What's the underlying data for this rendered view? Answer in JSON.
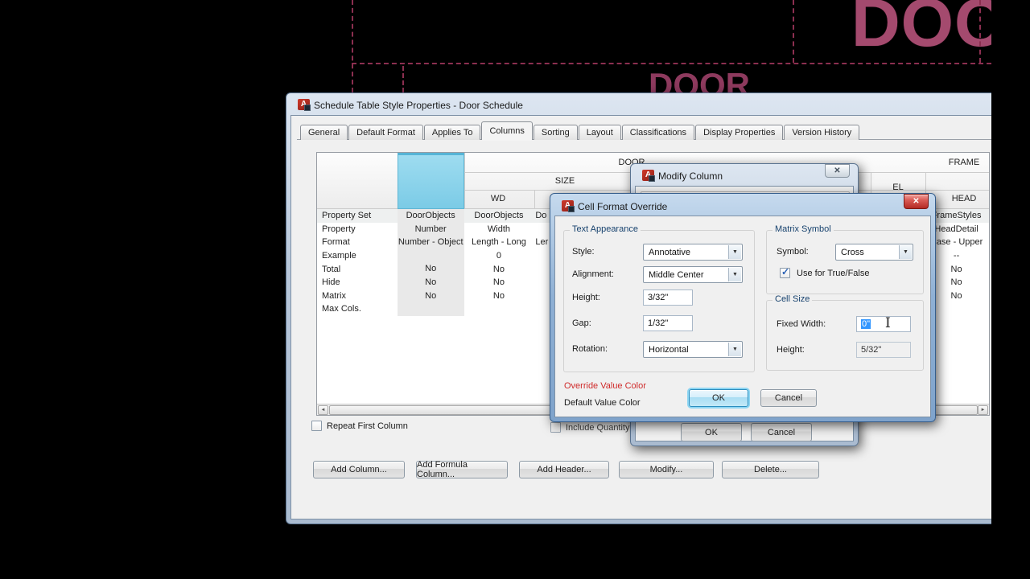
{
  "icons": {
    "close": "✕",
    "dropdown": "▼",
    "check": "✓",
    "scroll_left": "◄",
    "scroll_right": "►",
    "app_letter": "A",
    "ibeam": "I"
  },
  "background": {
    "door_large": "DOOR",
    "door_small": "DOOR"
  },
  "main_dialog": {
    "title": "Schedule Table Style Properties - Door Schedule",
    "tabs": [
      {
        "label": "General"
      },
      {
        "label": "Default Format"
      },
      {
        "label": "Applies To"
      },
      {
        "label": "Columns",
        "active": true
      },
      {
        "label": "Sorting"
      },
      {
        "label": "Layout"
      },
      {
        "label": "Classifications"
      },
      {
        "label": "Display Properties"
      },
      {
        "label": "Version History"
      }
    ],
    "table": {
      "group_header_left": "DOOR",
      "group_header_right": "FRAME",
      "sub_header_size": "SIZE",
      "sub_header_el": "EL",
      "col_header_wd": "WD",
      "col_header_head": "HEAD",
      "row_labels": [
        "Property Set",
        "Property",
        "Format",
        "Example",
        "Total",
        "Hide",
        "Matrix",
        "Max Cols."
      ],
      "col_selected": {
        "values": [
          "DoorObjects",
          "Number",
          "Number - Object",
          "",
          "No",
          "No",
          "No",
          ""
        ]
      },
      "col_wd": {
        "values": [
          "DoorObjects",
          "Width",
          "Length - Long",
          "0",
          "No",
          "No",
          "No",
          ""
        ]
      },
      "col_partial": {
        "values": [
          "Do",
          "",
          "Ler",
          "",
          "",
          "",
          "",
          ""
        ]
      },
      "col_head": {
        "values": [
          "FrameStyles",
          "HeadDetail",
          "Case - Upper",
          "--",
          "No",
          "No",
          "No",
          ""
        ]
      }
    },
    "repeat_first_column_label": "Repeat First Column",
    "include_quantity_label": "Include Quantity",
    "buttons": [
      {
        "label": "Add Column...",
        "name": "add-column-button"
      },
      {
        "label": "Add Formula Column...",
        "name": "add-formula-column-button"
      },
      {
        "label": "Add Header...",
        "name": "add-header-button"
      },
      {
        "label": "Modify...",
        "name": "modify-button"
      },
      {
        "label": "Delete...",
        "name": "delete-button"
      }
    ]
  },
  "modify_dialog": {
    "title": "Modify Column",
    "ok_label": "OK",
    "cancel_label": "Cancel"
  },
  "override_dialog": {
    "title": "Cell Format Override",
    "text_appearance": {
      "legend": "Text Appearance",
      "style_label": "Style:",
      "style_value": "Annotative",
      "alignment_label": "Alignment:",
      "alignment_value": "Middle Center",
      "height_label": "Height:",
      "height_value": "3/32\"",
      "gap_label": "Gap:",
      "gap_value": "1/32\"",
      "rotation_label": "Rotation:",
      "rotation_value": "Horizontal"
    },
    "matrix_symbol": {
      "legend": "Matrix Symbol",
      "symbol_label": "Symbol:",
      "symbol_value": "Cross",
      "use_for_truefalse_label": "Use for True/False",
      "checked": true
    },
    "cell_size": {
      "legend": "Cell Size",
      "fixed_width_label": "Fixed Width:",
      "fixed_width_value": "0\"",
      "height_label": "Height:",
      "height_value": "5/32\""
    },
    "override_value_color_label": "Override Value Color",
    "default_value_color_label": "Default Value Color",
    "ok_label": "OK",
    "cancel_label": "Cancel",
    "colors": {
      "override_label_red": "#cf2a2a",
      "selection_blue": "#3196ff",
      "drawing_pink": "#a44a6e"
    }
  }
}
